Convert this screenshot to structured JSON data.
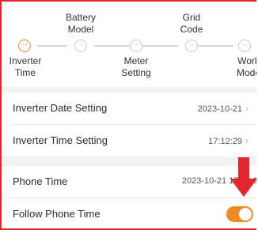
{
  "stepper": {
    "steps": [
      {
        "label": "Inverter\nTime",
        "state": "active",
        "icon": "ellipsis-icon"
      },
      {
        "label": "Battery\nModel",
        "state": "pending",
        "icon": "ellipsis-icon"
      },
      {
        "label": "Meter\nSetting",
        "state": "pending",
        "icon": "ellipsis-icon"
      },
      {
        "label": "Grid\nCode",
        "state": "pending",
        "icon": "ellipsis-icon"
      },
      {
        "label": "Work\nMode",
        "state": "pending",
        "icon": "ellipsis-icon"
      }
    ],
    "dots": "···"
  },
  "settings": {
    "date_label": "Inverter Date Setting",
    "date_value": "2023-10-21",
    "time_label": "Inverter Time Setting",
    "time_value": "17:12:29",
    "phone_time_label": "Phone Time",
    "phone_time_value": "2023-10-21 17:12:32",
    "follow_label": "Follow Phone Time",
    "follow_enabled": true
  },
  "colors": {
    "accent": "#f08a24",
    "annotation_border": "#e3262b",
    "annotation_arrow": "#e3262b"
  },
  "chevron": "›"
}
